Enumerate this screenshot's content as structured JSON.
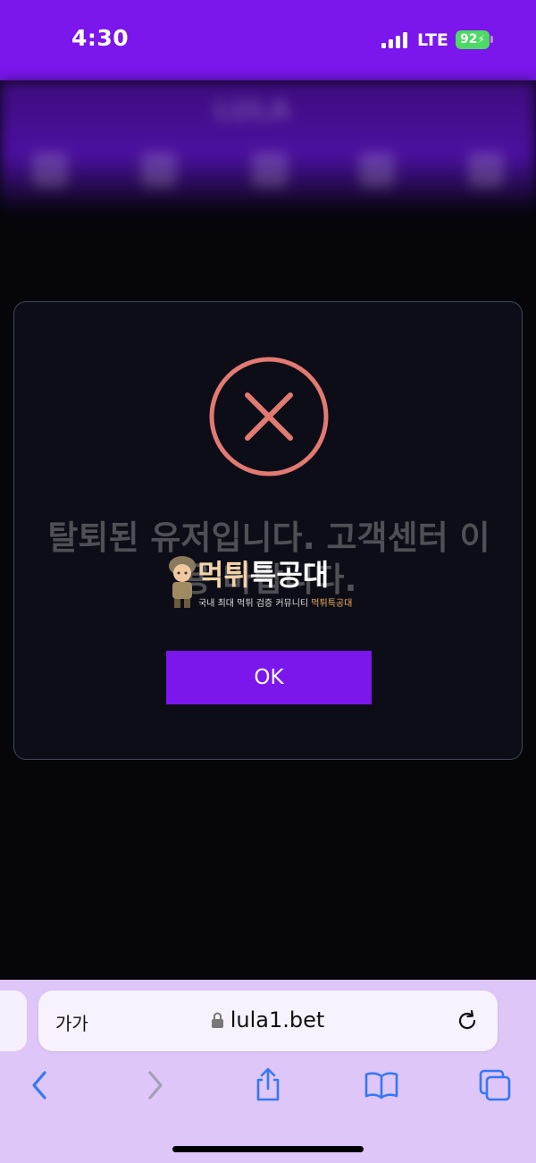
{
  "status_bar": {
    "time": "4:30",
    "network": "LTE",
    "battery": "92"
  },
  "site_header": {
    "logo_text": "LULA"
  },
  "dialog": {
    "message": "탈퇴된 유저입니다. 고객센터 이용 바랍니다.",
    "ok_label": "OK",
    "icon": "error-x-circle-icon",
    "icon_color": "#e27a72",
    "button_color": "#7b16ec"
  },
  "watermark": {
    "title_part1": "먹튀",
    "title_part2": "특공대",
    "subtitle_part1": "국내 최대 먹튀 검증 커뮤니티 ",
    "subtitle_part2": "먹튀특공대"
  },
  "browser": {
    "text_size_label": "가가",
    "url": "lula1.bet",
    "toolbar": [
      "back-icon",
      "forward-icon",
      "share-icon",
      "bookmarks-icon",
      "tabs-icon"
    ]
  },
  "colors": {
    "accent": "#7b16ec",
    "browser_bar": "#dec6f8",
    "toolbar_icon": "#3478f6"
  }
}
